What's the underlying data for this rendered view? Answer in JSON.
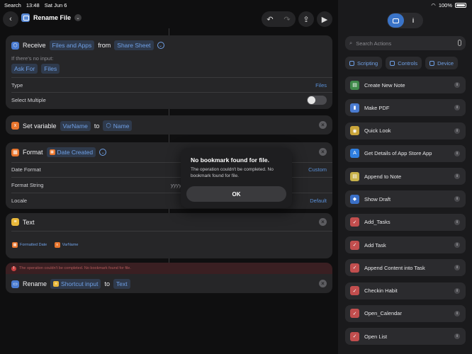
{
  "status": {
    "carrier": "Search",
    "time": "13:48",
    "date": "Sat Jun 6",
    "battery": "100%"
  },
  "toolbar": {
    "title": "Rename File"
  },
  "receive": {
    "verb": "Receive",
    "input_types": "Files and Apps",
    "from": "from",
    "source": "Share Sheet",
    "no_input_label": "If there's no input:",
    "ask_for": "Ask For",
    "ask_type": "Files",
    "type_label": "Type",
    "type_value": "Files",
    "select_multiple_label": "Select Multiple",
    "select_multiple": false
  },
  "set_variable": {
    "verb": "Set variable",
    "var_name": "VarName",
    "to": "to",
    "value": "Name"
  },
  "format": {
    "verb": "Format",
    "token": "Date Created",
    "date_format_label": "Date Format",
    "date_format_value": "Custom",
    "format_string_label": "Format String",
    "format_string_value": "yyyy",
    "locale_label": "Locale",
    "locale_value": "Default"
  },
  "text_action": {
    "verb": "Text",
    "token1": "Formatted Date",
    "token2": "VarName"
  },
  "error_banner": {
    "message": "The operation couldn't be completed. No bookmark found for file."
  },
  "rename": {
    "verb": "Rename",
    "token": "Shortcut input",
    "to": "to",
    "value": "Text"
  },
  "alert": {
    "title": "No bookmark found for file.",
    "message": "The operation couldn't be completed. No bookmark found for file.",
    "button": "OK"
  },
  "sidebar": {
    "search_placeholder": "Search Actions",
    "categories": [
      "Scripting",
      "Controls",
      "Device"
    ],
    "info_tab": "i",
    "items": [
      {
        "label": "Create New Note",
        "icon": "note-icon",
        "color": "#3f8a4a",
        "glyph": "▤"
      },
      {
        "label": "Make PDF",
        "icon": "pdf-icon",
        "color": "#4a7bd0",
        "glyph": "▮"
      },
      {
        "label": "Quick Look",
        "icon": "eye-icon",
        "color": "#c9a43a",
        "glyph": "◉"
      },
      {
        "label": "Get Details of App Store App",
        "icon": "appstore-icon",
        "color": "#2f7fe0",
        "glyph": "A"
      },
      {
        "label": "Append to Note",
        "icon": "note-icon",
        "color": "#c8b24a",
        "glyph": "▤"
      },
      {
        "label": "Show Draft",
        "icon": "draft-icon",
        "color": "#3a6fc6",
        "glyph": "◆"
      },
      {
        "label": "Add_Tasks",
        "icon": "check-icon",
        "color": "#c24e4e",
        "glyph": "✓"
      },
      {
        "label": "Add Task",
        "icon": "check-icon",
        "color": "#c24e4e",
        "glyph": "✓"
      },
      {
        "label": "Append Content into Task",
        "icon": "check-icon",
        "color": "#c24e4e",
        "glyph": "✓"
      },
      {
        "label": "Checkin Habit",
        "icon": "check-icon",
        "color": "#c24e4e",
        "glyph": "✓"
      },
      {
        "label": "Open_Calendar",
        "icon": "check-icon",
        "color": "#c24e4e",
        "glyph": "✓"
      },
      {
        "label": "Open List",
        "icon": "check-icon",
        "color": "#c24e4e",
        "glyph": "✓"
      }
    ]
  }
}
